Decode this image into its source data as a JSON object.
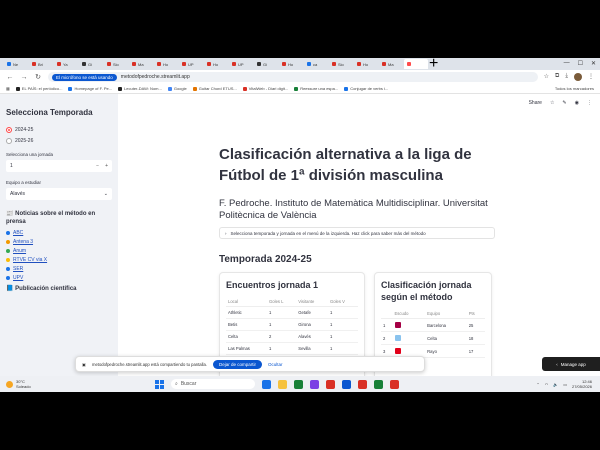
{
  "browser": {
    "tabs": [
      {
        "label": "Ne",
        "color": "#1a73e8"
      },
      {
        "label": "Bri",
        "color": "#d93025"
      },
      {
        "label": "Ya",
        "color": "#d93025"
      },
      {
        "label": "Gi",
        "color": "#333333"
      },
      {
        "label": "Sio",
        "color": "#d93025"
      },
      {
        "label": "Ma",
        "color": "#d93025"
      },
      {
        "label": "Ho",
        "color": "#d93025"
      },
      {
        "label": "UP",
        "color": "#d93025"
      },
      {
        "label": "Ho",
        "color": "#d93025"
      },
      {
        "label": "UP",
        "color": "#d93025"
      },
      {
        "label": "Gi",
        "color": "#333333"
      },
      {
        "label": "Ho",
        "color": "#d93025"
      },
      {
        "label": "ca",
        "color": "#1a73e8"
      },
      {
        "label": "Sio",
        "color": "#d93025"
      },
      {
        "label": "Ho",
        "color": "#d93025"
      },
      {
        "label": "Ma",
        "color": "#d93025"
      },
      {
        "label": "",
        "color": "#ff4b4b",
        "active": true
      }
    ],
    "mic_indicator": "El micrófono se está usando",
    "url": "metodofpedroche.streamlit.app",
    "bookmarks": [
      {
        "label": "EL PAÍS: el periódico...",
        "color": "#222222"
      },
      {
        "label": "Homepage of F. Pe...",
        "color": "#1a73e8"
      },
      {
        "label": "Lecuter-DAW: Nom...",
        "color": "#222222"
      },
      {
        "label": "Google",
        "color": "#4285f4"
      },
      {
        "label": "Guitar Chord ETUS...",
        "color": "#e37400"
      },
      {
        "label": "VitalWeb - Diari digit...",
        "color": "#d93025"
      },
      {
        "label": "Reessure una espa...",
        "color": "#188038"
      },
      {
        "label": "Conjugar de verbs i...",
        "color": "#1a73e8"
      }
    ],
    "bookmarks_all": "Todos los marcadores"
  },
  "sidebar": {
    "title": "Selecciona Temporada",
    "seasons": [
      {
        "label": "2024-25",
        "selected": true
      },
      {
        "label": "2025-26",
        "selected": false
      }
    ],
    "jornada_label": "Selecciona una jornada",
    "jornada_value": "1",
    "team_label": "Equipo a estudiar",
    "team_value": "Alavés",
    "news_title": "Noticias sobre el método en prensa",
    "news": [
      {
        "label": "ABC",
        "color": "#1a73e8"
      },
      {
        "label": "Antena 3",
        "color": "#f29900"
      },
      {
        "label": "Anum",
        "color": "#34a853"
      },
      {
        "label": "RTVE CV via X",
        "color": "#fbbc04"
      },
      {
        "label": "SER",
        "color": "#1a73e8"
      },
      {
        "label": "UPV",
        "color": "#1a73e8"
      }
    ],
    "publication_title": "Publicación científica"
  },
  "main": {
    "share_label": "Share",
    "title": "Clasificación alternativa a la liga de Fútbol de 1ª división masculina",
    "author": "F. Pedroche. Instituto de Matemàtica Multidisciplinar. Universitat Politècnica de València",
    "expander": "Selecciona temporada y jornada en el menú de la izquierda. Haz click para saber más del método",
    "season_heading": "Temporada 2024-25",
    "matches_card": {
      "title": "Encuentros jornada 1",
      "columns": [
        "Local",
        "Goles L",
        "Visitante",
        "Goles V"
      ],
      "rows": [
        [
          "Athletic",
          "1",
          "Getafe",
          "1"
        ],
        [
          "Betis",
          "1",
          "Girona",
          "1"
        ],
        [
          "Celta",
          "2",
          "Alavés",
          "1"
        ],
        [
          "Las Palmas",
          "1",
          "Sevilla",
          "1"
        ]
      ]
    },
    "ranking_card": {
      "title": "Clasificación jornada según el método",
      "columns": [
        "",
        "Escudo",
        "Equipo",
        "Pts"
      ],
      "rows": [
        {
          "pos": "1",
          "team": "Barcelona",
          "pts": "25",
          "crest": "#a50044"
        },
        {
          "pos": "2",
          "team": "Celta",
          "pts": "18",
          "crest": "#8ac3ee"
        },
        {
          "pos": "3",
          "team": "Rayo",
          "pts": "17",
          "crest": "#e2001a"
        }
      ]
    }
  },
  "share_bar": {
    "message": "metodofpedroche.streamlit.app está compartiendo tu pantalla.",
    "stop_label": "Dejar de compartir",
    "hide_label": "Ocultar"
  },
  "manage_app": "Manage app",
  "taskbar": {
    "temp": "30°C",
    "weather": "Soleado",
    "search_placeholder": "Buscar",
    "time": "12:46",
    "date": "27/05/2026",
    "apps": [
      "#1a73e8",
      "#f6c23e",
      "#188038",
      "#7b3fe4",
      "#d93025",
      "#0b57d0",
      "#d93025",
      "#188038",
      "#d93025"
    ]
  }
}
